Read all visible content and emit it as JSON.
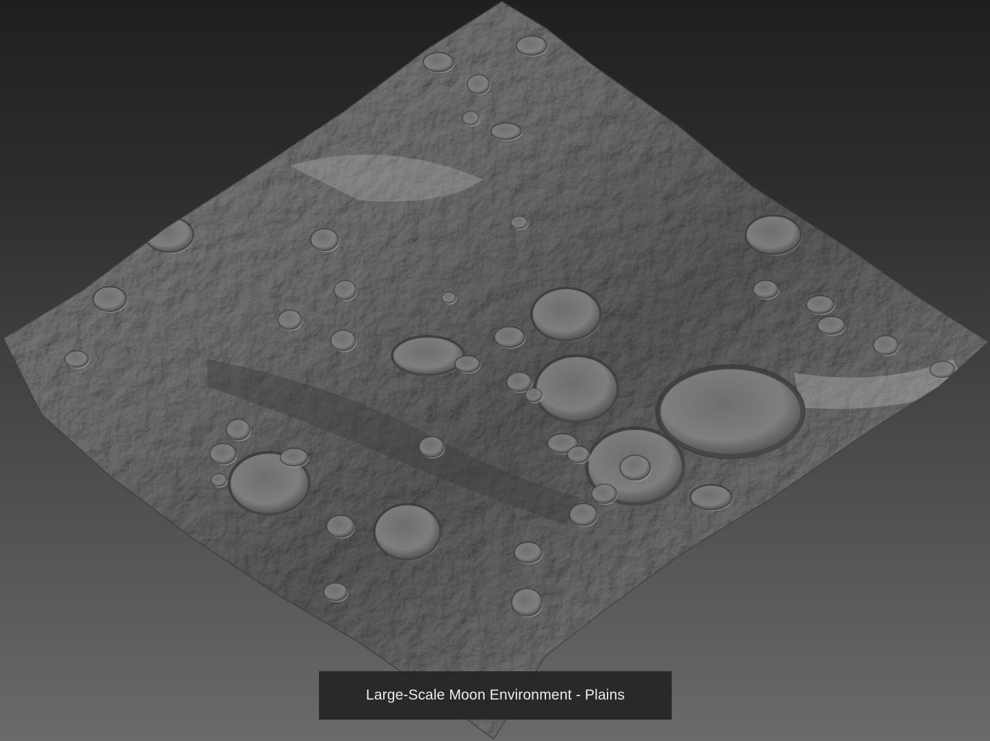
{
  "caption": {
    "text": "Large-Scale Moon Environment - Plains"
  },
  "scene": {
    "subject": "lunar-terrain-tile",
    "colors": {
      "background_top": "#1f1f1f",
      "background_bottom": "#6a6a6a",
      "terrain_light": "#a9a9a9",
      "terrain_mid": "#7c7c7c",
      "terrain_dark": "#4b4b4b",
      "caption_bg": "#242424",
      "caption_text": "#ececec"
    }
  }
}
